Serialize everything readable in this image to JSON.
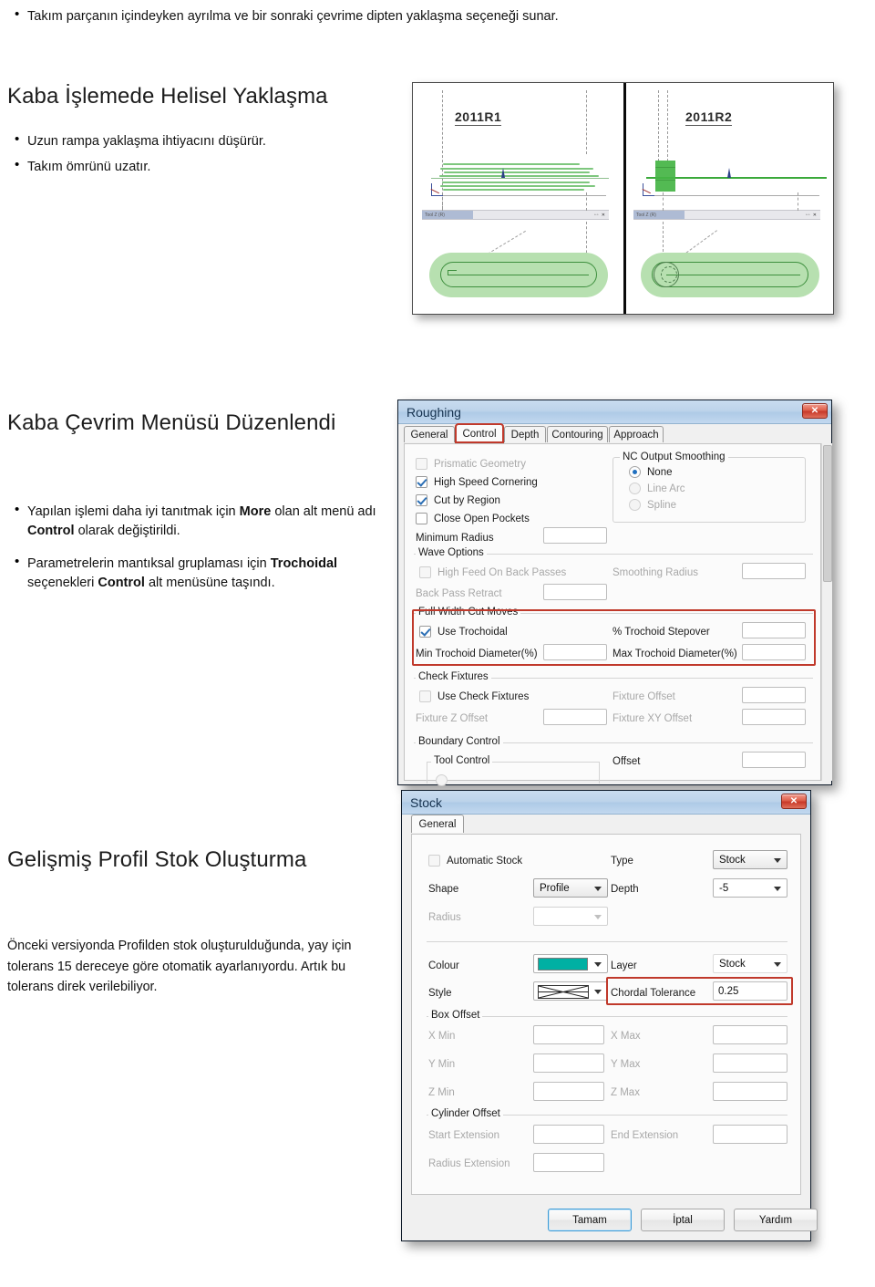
{
  "slide": {
    "top_bullet": "Takım parçanın içindeyken ayrılma ve bir sonraki çevrime dipten yaklaşma seçeneği sunar.",
    "section1": {
      "title": "Kaba İşlemede Helisel Yaklaşma",
      "bullets": [
        "Uzun rampa yaklaşma ihtiyacını düşürür.",
        "Takım ömrünü uzatır."
      ]
    },
    "section2": {
      "title": "Kaba Çevrim Menüsü Düzenlendi",
      "bullet1_pre": "Yapılan işlemi daha iyi tanıtmak için ",
      "bullet1_b1": "More",
      "bullet1_mid": " olan alt menü adı ",
      "bullet1_b2": "Control",
      "bullet1_post": " olarak değiştirildi.",
      "bullet2_pre": "Parametrelerin mantıksal gruplaması için ",
      "bullet2_b1": "Trochoidal",
      "bullet2_mid": " seçenekleri ",
      "bullet2_b2": "Control",
      "bullet2_post": " alt menüsüne taşındı."
    },
    "section3": {
      "title": "Gelişmiş Profil Stok Oluşturma",
      "paragraph": "Önceki versiyonda Profilden stok oluşturulduğunda, yay için tolerans 15 dereceye göre otomatik ayarlanıyordu. Artık bu tolerans direk verilebiliyor."
    }
  },
  "cam_figure": {
    "left_label": "2011R1",
    "right_label": "2011R2",
    "mini_window_title": "Tool Z (R)",
    "mini_window_buttons": "▫▫ ✕"
  },
  "roughing_dialog": {
    "title": "Roughing",
    "close_glyph": "✕",
    "tabs": [
      {
        "label": "General",
        "active": false,
        "highlighted": false
      },
      {
        "label": "Control",
        "active": true,
        "highlighted": true
      },
      {
        "label": "Depth",
        "active": false,
        "highlighted": false
      },
      {
        "label": "Contouring",
        "active": false,
        "highlighted": false
      },
      {
        "label": "Approach",
        "active": false,
        "highlighted": false
      }
    ],
    "checkboxes": {
      "prismatic_geometry": {
        "label": "Prismatic Geometry",
        "checked": false,
        "enabled": false
      },
      "high_speed_cornering": {
        "label": "High Speed Cornering",
        "checked": true,
        "enabled": true
      },
      "cut_by_region": {
        "label": "Cut by Region",
        "checked": true,
        "enabled": true
      },
      "close_open_pockets": {
        "label": "Close Open Pockets",
        "checked": false,
        "enabled": true
      }
    },
    "minimum_radius": {
      "label": "Minimum Radius",
      "value": ""
    },
    "nc_output_smoothing": {
      "caption": "NC Output Smoothing",
      "options": [
        {
          "label": "None",
          "selected": true,
          "enabled": true
        },
        {
          "label": "Line Arc",
          "selected": false,
          "enabled": false
        },
        {
          "label": "Spline",
          "selected": false,
          "enabled": false
        }
      ]
    },
    "wave_options": {
      "caption": "Wave Options",
      "high_feed_on_back_passes": {
        "label": "High Feed On Back Passes",
        "checked": false,
        "enabled": false
      },
      "smoothing_radius": {
        "label": "Smoothing Radius",
        "value": ""
      },
      "back_pass_retract": {
        "label": "Back Pass Retract",
        "value": ""
      }
    },
    "full_width_cut_moves": {
      "caption": "Full Width Cut Moves",
      "use_trochoidal": {
        "label": "Use Trochoidal",
        "checked": true,
        "enabled": true
      },
      "trochoid_stepover": {
        "label": "% Trochoid Stepover",
        "value": ""
      },
      "min_trochoid_diameter": {
        "label": "Min Trochoid Diameter(%)",
        "value": ""
      },
      "max_trochoid_diameter": {
        "label": "Max Trochoid Diameter(%)",
        "value": ""
      }
    },
    "check_fixtures": {
      "caption": "Check Fixtures",
      "use_check_fixtures": {
        "label": "Use Check Fixtures",
        "checked": false,
        "enabled": false
      },
      "fixture_offset": {
        "label": "Fixture Offset",
        "value": ""
      },
      "fixture_z_offset": {
        "label": "Fixture Z Offset",
        "value": ""
      },
      "fixture_xy_offset": {
        "label": "Fixture XY Offset",
        "value": ""
      }
    },
    "boundary_control": {
      "caption": "Boundary Control",
      "tool_control_caption": "Tool Control",
      "offset": {
        "label": "Offset",
        "value": ""
      }
    }
  },
  "stock_dialog": {
    "title": "Stock",
    "close_glyph": "✕",
    "tab": "General",
    "automatic_stock": {
      "label": "Automatic Stock",
      "checked": false,
      "enabled": false
    },
    "type": {
      "label": "Type",
      "value": "Stock"
    },
    "shape": {
      "label": "Shape",
      "value": "Profile"
    },
    "depth": {
      "label": "Depth",
      "value": "-5"
    },
    "radius": {
      "label": "Radius",
      "value": "",
      "enabled": false
    },
    "colour": {
      "label": "Colour",
      "swatch_hex": "#00B0A3"
    },
    "layer": {
      "label": "Layer",
      "value": "Stock"
    },
    "style": {
      "label": "Style",
      "value": ""
    },
    "chordal_tolerance": {
      "label": "Chordal Tolerance",
      "value": "0.25"
    },
    "box_offset": {
      "caption": "Box Offset",
      "fields": [
        {
          "label": "X Min",
          "value": ""
        },
        {
          "label": "X Max",
          "value": ""
        },
        {
          "label": "Y Min",
          "value": ""
        },
        {
          "label": "Y Max",
          "value": ""
        },
        {
          "label": "Z Min",
          "value": ""
        },
        {
          "label": "Z Max",
          "value": ""
        }
      ]
    },
    "cylinder_offset": {
      "caption": "Cylinder Offset",
      "start_extension": {
        "label": "Start Extension",
        "value": ""
      },
      "end_extension": {
        "label": "End Extension",
        "value": ""
      },
      "radius_extension": {
        "label": "Radius Extension",
        "value": ""
      }
    },
    "buttons": {
      "ok": "Tamam",
      "cancel": "İptal",
      "help": "Yardım"
    }
  },
  "colors": {
    "accent_red": "#c0392b",
    "title_blue": "#aecae6",
    "teal_swatch": "#00B0A3",
    "toolpath_green": "#3aa93a"
  }
}
